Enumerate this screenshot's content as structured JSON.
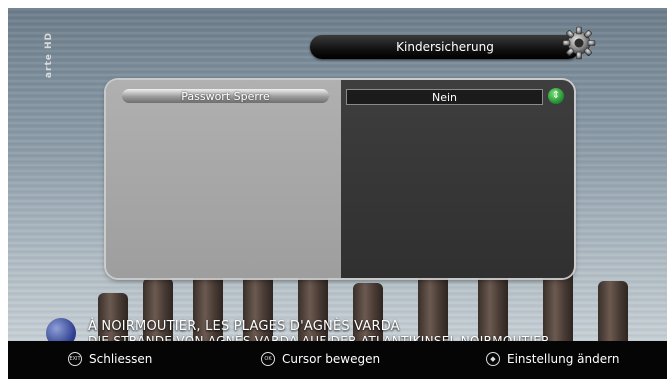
{
  "channel": {
    "logo": "arte HD"
  },
  "header": {
    "title": "Kindersicherung",
    "icon": "gear-icon"
  },
  "menu": {
    "items": [
      {
        "label": "Passwort Sperre",
        "value": "Nein",
        "icon": "toggle-icon"
      }
    ]
  },
  "video": {
    "subtitle_line1": "À NOIRMOUTIER, LES PLAGES D'AGNÈS VARDA",
    "subtitle_line2": "DIE STRÄNDE VON AGNÈS VARDA AUF DER ATLANTIKINSEL NOIRMOUTIER"
  },
  "footer": {
    "items": [
      {
        "key": "EXIT",
        "label": "Schliessen"
      },
      {
        "key": "OK",
        "label": "Cursor bewegen"
      },
      {
        "key": "◆",
        "label": "Einstellung ändern"
      }
    ]
  },
  "colors": {
    "accent": "#1c8a2c",
    "panel_left": "#a8a8a8",
    "panel_right": "#363636"
  }
}
